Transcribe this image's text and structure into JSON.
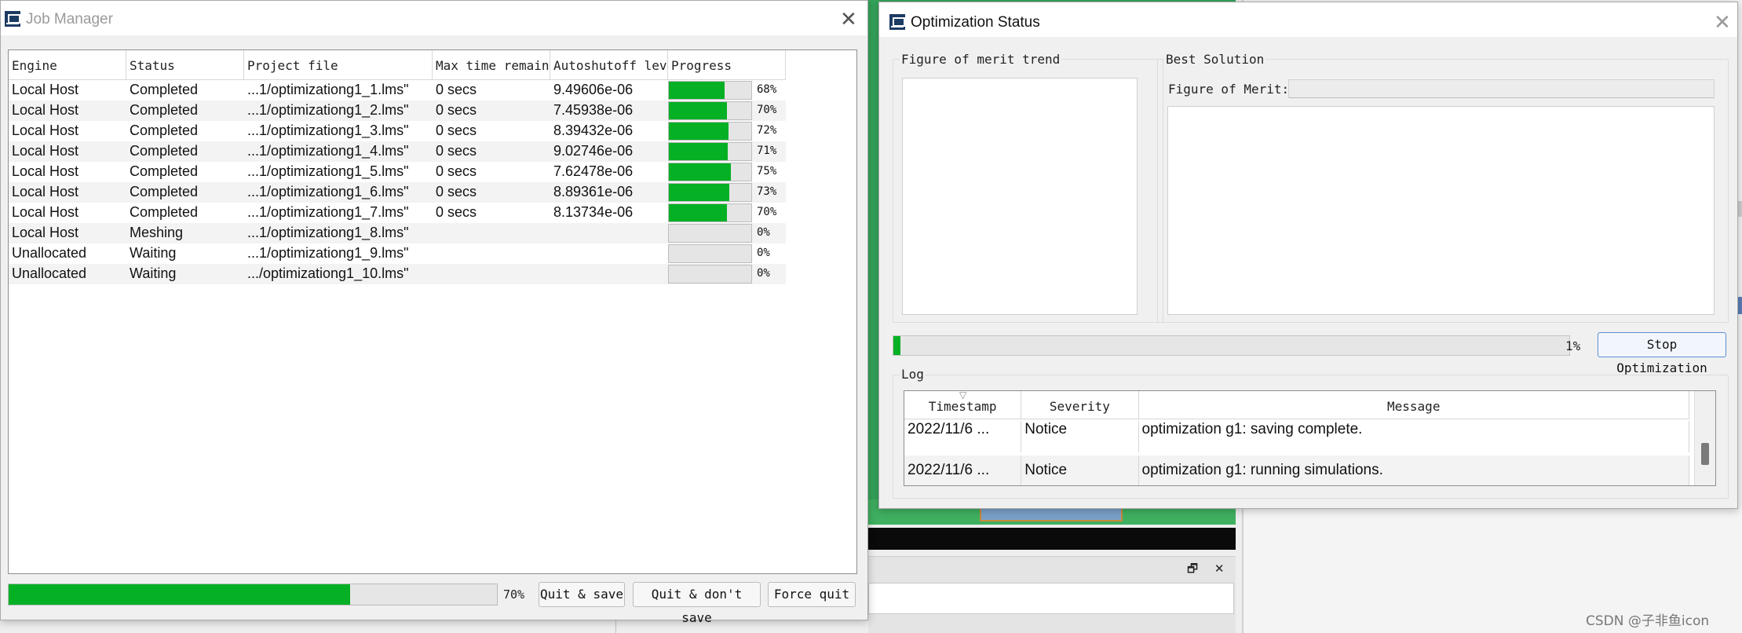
{
  "background": {
    "panel_buttons": "🗗 ✕",
    "watermark": "CSDN @子非鱼icon"
  },
  "job_manager": {
    "title": "Job Manager",
    "columns": [
      "Engine",
      "Status",
      "Project file",
      "Max time remaini",
      "Autoshutoff leve",
      "Progress"
    ],
    "rows": [
      {
        "engine": "Local Host",
        "status": "Completed",
        "file": "...1/optimizationg1_1.lms\"",
        "max_time": "0 secs",
        "autoshutoff": "9.49606e-06",
        "progress": 68,
        "progress_label": "68%"
      },
      {
        "engine": "Local Host",
        "status": "Completed",
        "file": "...1/optimizationg1_2.lms\"",
        "max_time": "0 secs",
        "autoshutoff": "7.45938e-06",
        "progress": 70,
        "progress_label": "70%"
      },
      {
        "engine": "Local Host",
        "status": "Completed",
        "file": "...1/optimizationg1_3.lms\"",
        "max_time": "0 secs",
        "autoshutoff": "8.39432e-06",
        "progress": 72,
        "progress_label": "72%"
      },
      {
        "engine": "Local Host",
        "status": "Completed",
        "file": "...1/optimizationg1_4.lms\"",
        "max_time": "0 secs",
        "autoshutoff": "9.02746e-06",
        "progress": 71,
        "progress_label": "71%"
      },
      {
        "engine": "Local Host",
        "status": "Completed",
        "file": "...1/optimizationg1_5.lms\"",
        "max_time": "0 secs",
        "autoshutoff": "7.62478e-06",
        "progress": 75,
        "progress_label": "75%"
      },
      {
        "engine": "Local Host",
        "status": "Completed",
        "file": "...1/optimizationg1_6.lms\"",
        "max_time": "0 secs",
        "autoshutoff": "8.89361e-06",
        "progress": 73,
        "progress_label": "73%"
      },
      {
        "engine": "Local Host",
        "status": "Completed",
        "file": "...1/optimizationg1_7.lms\"",
        "max_time": "0 secs",
        "autoshutoff": "8.13734e-06",
        "progress": 70,
        "progress_label": "70%"
      },
      {
        "engine": "Local Host",
        "status": "Meshing",
        "file": "...1/optimizationg1_8.lms\"",
        "max_time": "",
        "autoshutoff": "",
        "progress": 0,
        "progress_label": "0%"
      },
      {
        "engine": "Unallocated",
        "status": "Waiting",
        "file": "...1/optimizationg1_9.lms\"",
        "max_time": "",
        "autoshutoff": "",
        "progress": 0,
        "progress_label": "0%"
      },
      {
        "engine": "Unallocated",
        "status": "Waiting",
        "file": ".../optimizationg1_10.lms\"",
        "max_time": "",
        "autoshutoff": "",
        "progress": 0,
        "progress_label": "0%"
      }
    ],
    "overall_progress": 70,
    "overall_progress_label": "70%",
    "buttons": {
      "quit_save": "Quit & save",
      "quit_dont_save": "Quit & don't save",
      "force_quit": "Force quit"
    }
  },
  "optimization_status": {
    "title": "Optimization Status",
    "fom_trend_title": "Figure of merit trend",
    "best_solution_title": "Best Solution",
    "fom_label": "Figure of Merit:",
    "fom_value": "",
    "progress": 1,
    "progress_label": "1%",
    "stop_button": "Stop Optimization",
    "log_title": "Log",
    "log_columns": [
      "Timestamp",
      "Severity",
      "Message"
    ],
    "log_rows": [
      {
        "timestamp": "2022/11/6 ...",
        "severity": "Notice",
        "message": "optimization g1: saving complete."
      },
      {
        "timestamp": "2022/11/6 ...",
        "severity": "Notice",
        "message": "optimization g1: running simulations."
      }
    ]
  }
}
